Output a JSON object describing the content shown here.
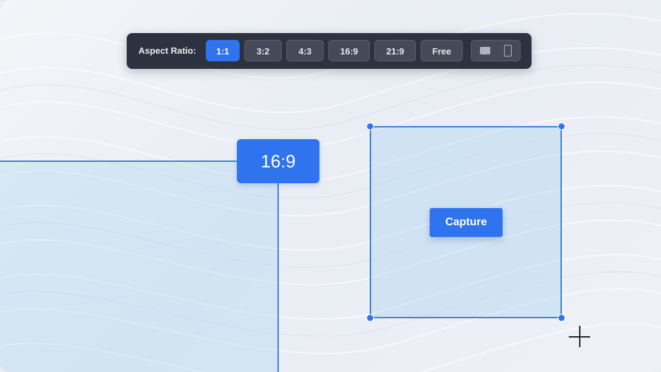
{
  "toolbar": {
    "label": "Aspect Ratio:",
    "ratios": [
      {
        "label": "1:1",
        "active": true
      },
      {
        "label": "3:2",
        "active": false
      },
      {
        "label": "4:3",
        "active": false
      },
      {
        "label": "16:9",
        "active": false
      },
      {
        "label": "21:9",
        "active": false
      },
      {
        "label": "Free",
        "active": false
      }
    ],
    "orientation": {
      "options": [
        "landscape-icon",
        "portrait-icon"
      ]
    }
  },
  "left_selection": {
    "ratio_label": "16:9"
  },
  "right_selection": {
    "ratio": "1:1",
    "capture_label": "Capture"
  },
  "colors": {
    "accent": "#2f73ee",
    "toolbar_bg": "#2e3240",
    "selection_border": "#3a7fd6"
  }
}
